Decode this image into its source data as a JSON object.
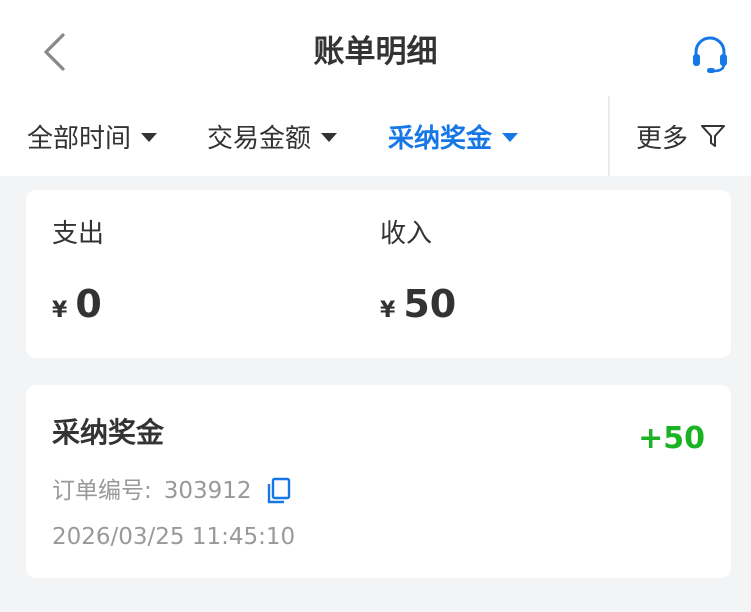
{
  "header": {
    "title": "账单明细",
    "back_icon": "chevron-left-icon",
    "service_icon": "headset-icon"
  },
  "filters": [
    {
      "label": "全部时间",
      "active": false
    },
    {
      "label": "交易金额",
      "active": false
    },
    {
      "label": "采纳奖金",
      "active": true
    }
  ],
  "more": {
    "label": "更多",
    "icon": "filter-funnel-icon"
  },
  "summary": {
    "expense_label": "支出",
    "expense_currency": "¥",
    "expense_value": "0",
    "income_label": "收入",
    "income_currency": "¥",
    "income_value": "50"
  },
  "records": [
    {
      "title": "采纳奖金",
      "amount": "+50",
      "order_label": "订单编号:",
      "order_no": "303912",
      "time": "2026/03/25 11:45:10"
    }
  ],
  "colors": {
    "accent": "#1677e6",
    "income_green": "#1bb324",
    "background": "#f3f4f6"
  }
}
